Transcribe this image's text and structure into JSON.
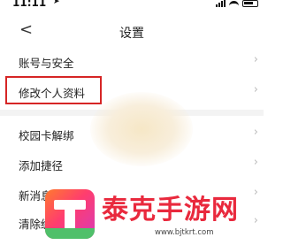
{
  "status_bar": {
    "time": "11:11",
    "location_arrow": "➤"
  },
  "nav": {
    "back": "<",
    "title": "设置"
  },
  "menu": {
    "items": [
      {
        "label": "账号与安全",
        "chevron": "›"
      },
      {
        "label": "修改个人资料",
        "chevron": "›"
      },
      {
        "label": "校园卡解绑",
        "chevron": "›"
      },
      {
        "label": "添加捷径",
        "chevron": "›"
      },
      {
        "label": "新消息",
        "chevron": "›"
      },
      {
        "label": "清除缓存",
        "chevron": "›"
      }
    ]
  },
  "highlight": {
    "target": "修改个人资料",
    "color": "#d62525"
  },
  "watermark": {
    "text": "泰克手游网",
    "url": "www.bjtkrt.com",
    "text_color": "#e9293d"
  },
  "icons": [
    "back-icon",
    "chevron-right-icon",
    "signal-icon",
    "wifi-icon",
    "battery-icon",
    "location-arrow-icon"
  ]
}
